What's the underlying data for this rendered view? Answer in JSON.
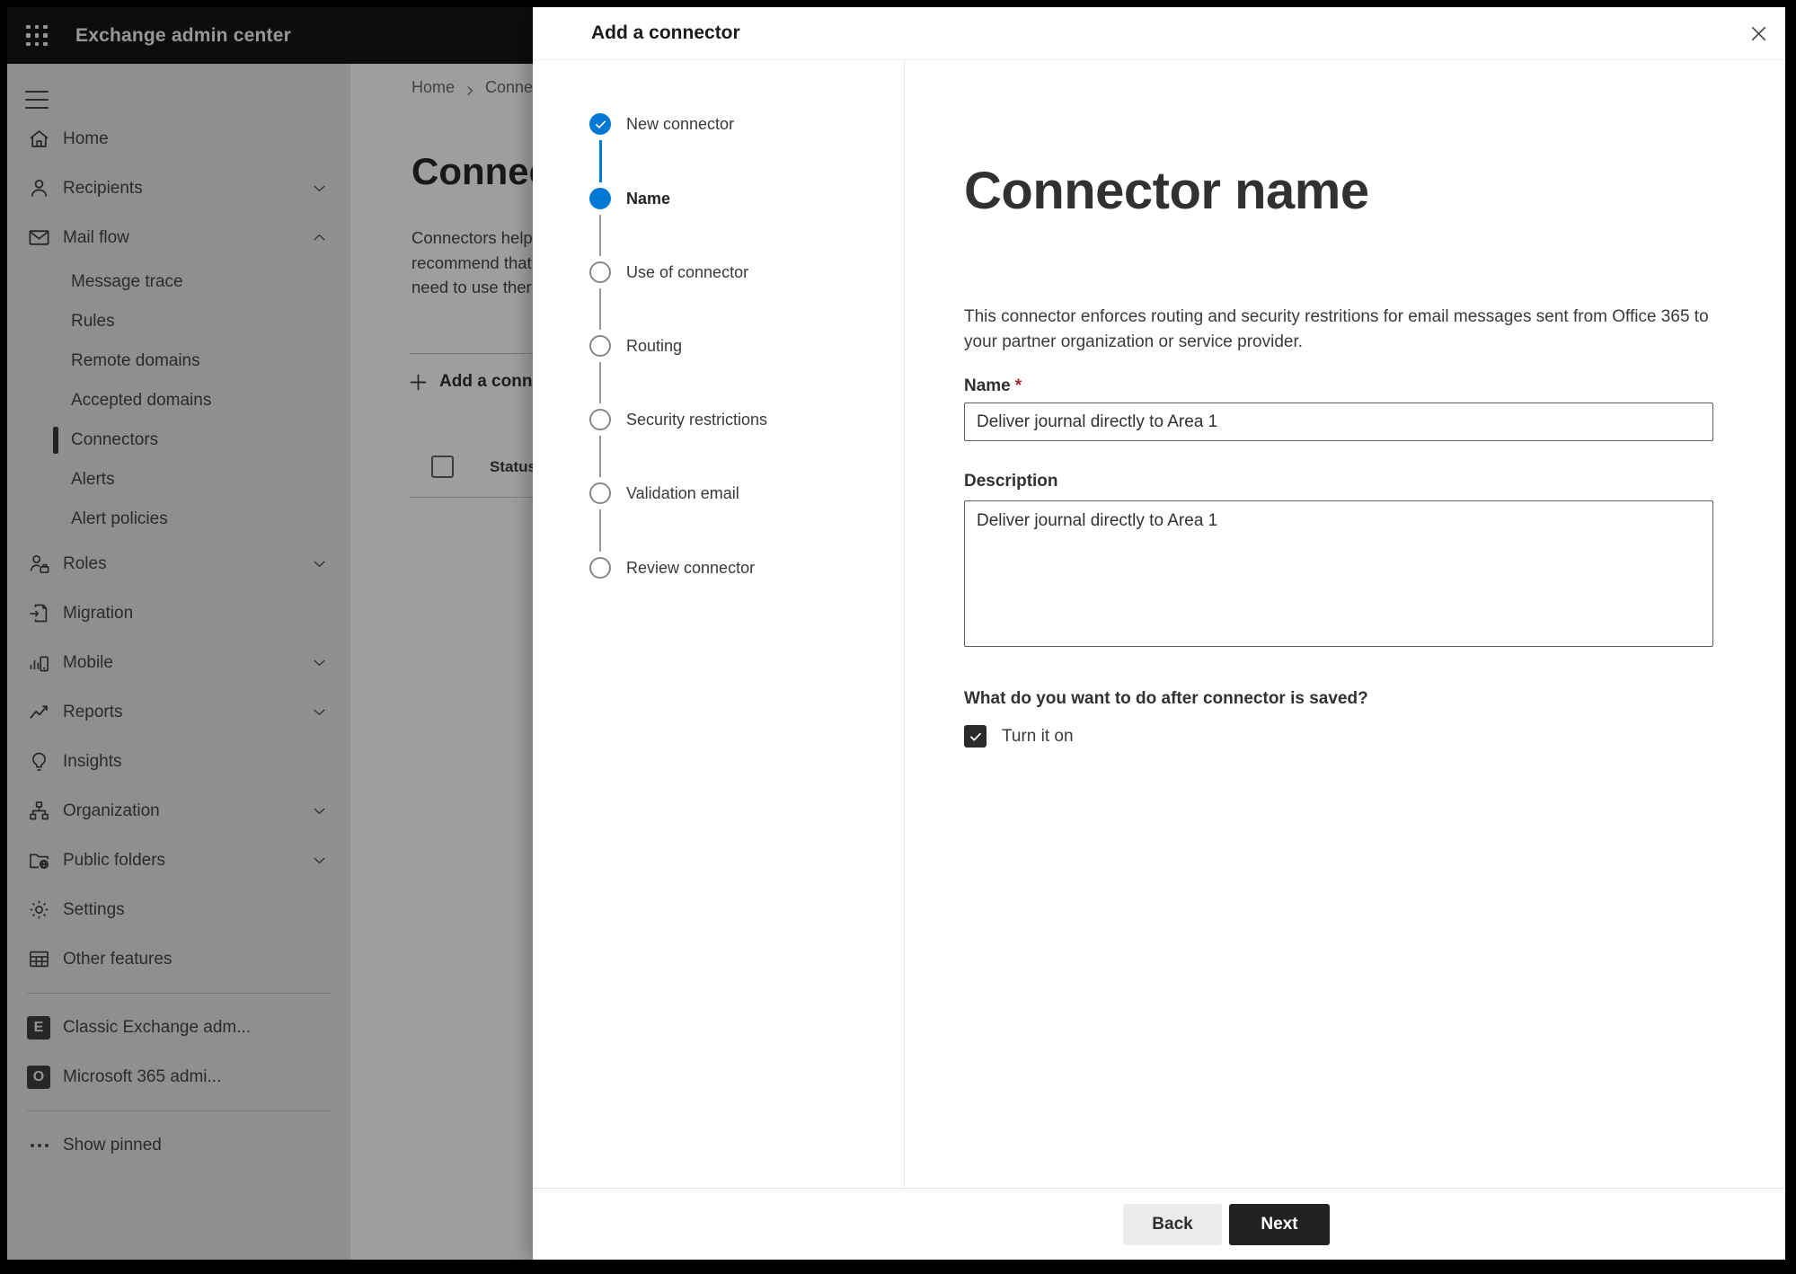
{
  "colors": {
    "accent": "#0078d4",
    "topbar_bg": "#161616",
    "next_button_bg": "#222222",
    "required_mark": "#a4262c"
  },
  "app": {
    "title": "Exchange admin center"
  },
  "sidebar": {
    "items": [
      {
        "label": "Home",
        "icon": "home-icon",
        "type": "main"
      },
      {
        "label": "Recipients",
        "icon": "person-icon",
        "type": "main",
        "chevron": "down"
      },
      {
        "label": "Mail flow",
        "icon": "mail-icon",
        "type": "main",
        "chevron": "up"
      },
      {
        "label": "Message trace",
        "type": "sub"
      },
      {
        "label": "Rules",
        "type": "sub"
      },
      {
        "label": "Remote domains",
        "type": "sub"
      },
      {
        "label": "Accepted domains",
        "type": "sub"
      },
      {
        "label": "Connectors",
        "type": "sub",
        "selected": true
      },
      {
        "label": "Alerts",
        "type": "sub"
      },
      {
        "label": "Alert policies",
        "type": "sub"
      },
      {
        "label": "Roles",
        "icon": "roles-icon",
        "type": "main",
        "chevron": "down"
      },
      {
        "label": "Migration",
        "icon": "migration-icon",
        "type": "main"
      },
      {
        "label": "Mobile",
        "icon": "mobile-icon",
        "type": "main",
        "chevron": "down"
      },
      {
        "label": "Reports",
        "icon": "reports-icon",
        "type": "main",
        "chevron": "down"
      },
      {
        "label": "Insights",
        "icon": "insights-icon",
        "type": "main"
      },
      {
        "label": "Organization",
        "icon": "organization-icon",
        "type": "main",
        "chevron": "down"
      },
      {
        "label": "Public folders",
        "icon": "public-folders-icon",
        "type": "main",
        "chevron": "down"
      },
      {
        "label": "Settings",
        "icon": "settings-icon",
        "type": "main"
      },
      {
        "label": "Other features",
        "icon": "other-features-icon",
        "type": "main"
      },
      {
        "label": "Classic Exchange adm...",
        "icon": "classic-exchange-icon",
        "type": "link",
        "divider_before": true,
        "block_letter": "E"
      },
      {
        "label": "Microsoft 365 admi...",
        "icon": "microsoft-365-icon",
        "type": "link",
        "block_letter": "O"
      },
      {
        "label": "Show pinned",
        "icon": "ellipsis-icon",
        "type": "link",
        "divider_before": true
      }
    ]
  },
  "page": {
    "breadcrumb": {
      "home": "Home",
      "current": "Conne"
    },
    "heading": "Connec",
    "description_lines": [
      "Connectors help",
      "recommend that",
      "need to use ther"
    ],
    "add_button_label": "Add a conn",
    "table": {
      "status_header": "Status"
    }
  },
  "panel": {
    "title": "Add a connector",
    "steps": [
      {
        "label": "New connector",
        "state": "completed"
      },
      {
        "label": "Name",
        "state": "current"
      },
      {
        "label": "Use of connector",
        "state": "pending"
      },
      {
        "label": "Routing",
        "state": "pending"
      },
      {
        "label": "Security restrictions",
        "state": "pending"
      },
      {
        "label": "Validation email",
        "state": "pending"
      },
      {
        "label": "Review connector",
        "state": "pending"
      }
    ],
    "content": {
      "heading": "Connector name",
      "description": "This connector enforces routing and security restritions for email messages sent from Office 365 to your partner organization or service provider.",
      "name_label": "Name",
      "required_mark": "*",
      "name_value": "Deliver journal directly to Area 1",
      "description_label": "Description",
      "description_value": "Deliver journal directly to Area 1",
      "after_save_question": "What do you want to do after connector is saved?",
      "turn_on_label": "Turn it on",
      "turn_on_checked": true
    },
    "footer": {
      "back_label": "Back",
      "next_label": "Next"
    }
  }
}
